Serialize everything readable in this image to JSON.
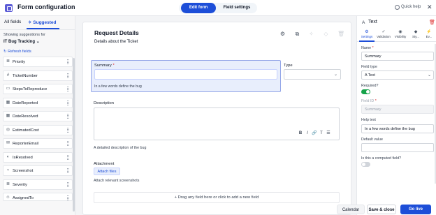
{
  "header": {
    "title": "Form configuration",
    "mode_tabs": [
      {
        "label": "Edit form",
        "active": true
      },
      {
        "label": "Field settings",
        "active": false
      }
    ],
    "quick_help_label": "Quick help",
    "accent_color": "#1d4ed8"
  },
  "sidebar": {
    "tabs": [
      {
        "label": "All fields"
      },
      {
        "label": "Suggested",
        "active": true
      }
    ],
    "showing_label": "Showing suggestions for",
    "selected_template": "IT Bug Tracking",
    "refresh_label": "Refresh fields",
    "fields": [
      {
        "label": "Priority",
        "icon": "list-icon"
      },
      {
        "label": "TicketNumber",
        "icon": "number-icon"
      },
      {
        "label": "StepsToReproduce",
        "icon": "text-icon"
      },
      {
        "label": "DateReported",
        "icon": "calendar-icon"
      },
      {
        "label": "DateResolved",
        "icon": "calendar-icon"
      },
      {
        "label": "EstimatedCost",
        "icon": "currency-icon"
      },
      {
        "label": "ReporterEmail",
        "icon": "email-icon"
      },
      {
        "label": "IsResolved",
        "icon": "toggle-icon"
      },
      {
        "label": "Screenshot",
        "icon": "attachment-icon"
      },
      {
        "label": "Severity",
        "icon": "list-icon"
      },
      {
        "label": "AssignedTo",
        "icon": "person-icon"
      }
    ]
  },
  "form": {
    "title": "Request Details",
    "subtitle": "Details about the Ticket",
    "summary": {
      "label": "Summary",
      "required_mark": "*",
      "help": "In a few words define the bug"
    },
    "type": {
      "label": "Type"
    },
    "description": {
      "label": "Description",
      "toolbar": [
        "B",
        "I",
        "🔗",
        "T",
        "☰"
      ],
      "help": "A detailed description of the bug"
    },
    "attachment": {
      "label": "Attachment",
      "button_label": "Attach files",
      "help": "Attach relevant screenshots"
    },
    "drop_zone_label": "+ Drag any field here or click to add a new field"
  },
  "properties": {
    "field_type_title": "Text",
    "tabs": [
      {
        "label": "Settings",
        "icon": "gear-icon",
        "active": true
      },
      {
        "label": "Validation",
        "icon": "check-icon"
      },
      {
        "label": "Visibility",
        "icon": "eye-icon"
      },
      {
        "label": "Sty...",
        "icon": "style-icon"
      },
      {
        "label": "Ev...",
        "icon": "event-icon"
      }
    ],
    "name_label": "Name",
    "name_value": "Summary",
    "field_type_label": "Field type",
    "field_type_value": "Text",
    "required_label": "Required?",
    "required_on": true,
    "field_id_label": "Field ID",
    "field_id_value": "Summary",
    "help_text_label": "Help text",
    "help_text_value": "In a few words define the bug",
    "default_label": "Default value",
    "default_value": "",
    "computed_label": "Is this a computed field?",
    "computed_on": false
  },
  "footer": {
    "calendar_label": "Calendar",
    "save_label": "Save & close",
    "live_label": "Go live"
  }
}
